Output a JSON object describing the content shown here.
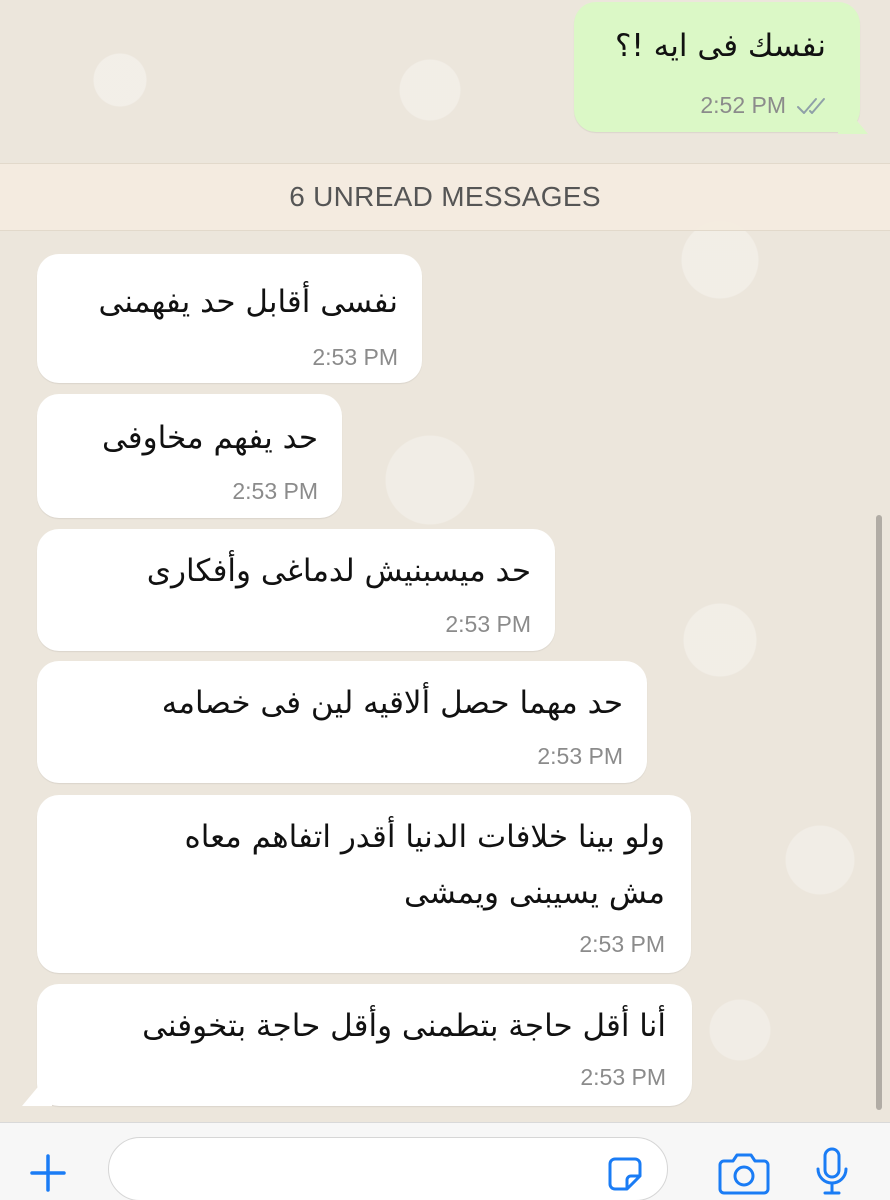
{
  "messages": [
    {
      "direction": "out",
      "text": "نفسك فى ايه !؟",
      "time": "2:52 PM",
      "status": "read-double-check-icon"
    },
    {
      "direction": "in",
      "lines": [
        "نفسى أقابل حد يفهمنى"
      ],
      "time": "2:53 PM"
    },
    {
      "direction": "in",
      "lines": [
        "حد يفهم مخاوفى"
      ],
      "time": "2:53 PM"
    },
    {
      "direction": "in",
      "lines": [
        "حد ميسبنيش لدماغى وأفكارى"
      ],
      "time": "2:53 PM"
    },
    {
      "direction": "in",
      "lines": [
        "حد مهما حصل ألاقيه لين فى خصامه"
      ],
      "time": "2:53 PM"
    },
    {
      "direction": "in",
      "lines": [
        "ولو بينا خلافات الدنيا أقدر اتفاهم معاه",
        "مش يسيبنى ويمشى"
      ],
      "time": "2:53 PM"
    },
    {
      "direction": "in",
      "lines": [
        "أنا أقل حاجة بتطمنى وأقل حاجة بتخوفنى"
      ],
      "time": "2:53 PM"
    }
  ],
  "unread_banner": "6 UNREAD MESSAGES",
  "bottom_bar": {
    "icons": [
      "plus-icon",
      "sticker-icon",
      "camera-icon",
      "microphone-icon"
    ],
    "accent_color": "#1a7cf5"
  },
  "colors": {
    "incoming_bubble": "#ffffff",
    "outgoing_bubble": "#dbf8c6",
    "chat_background": "#ece6dc"
  }
}
